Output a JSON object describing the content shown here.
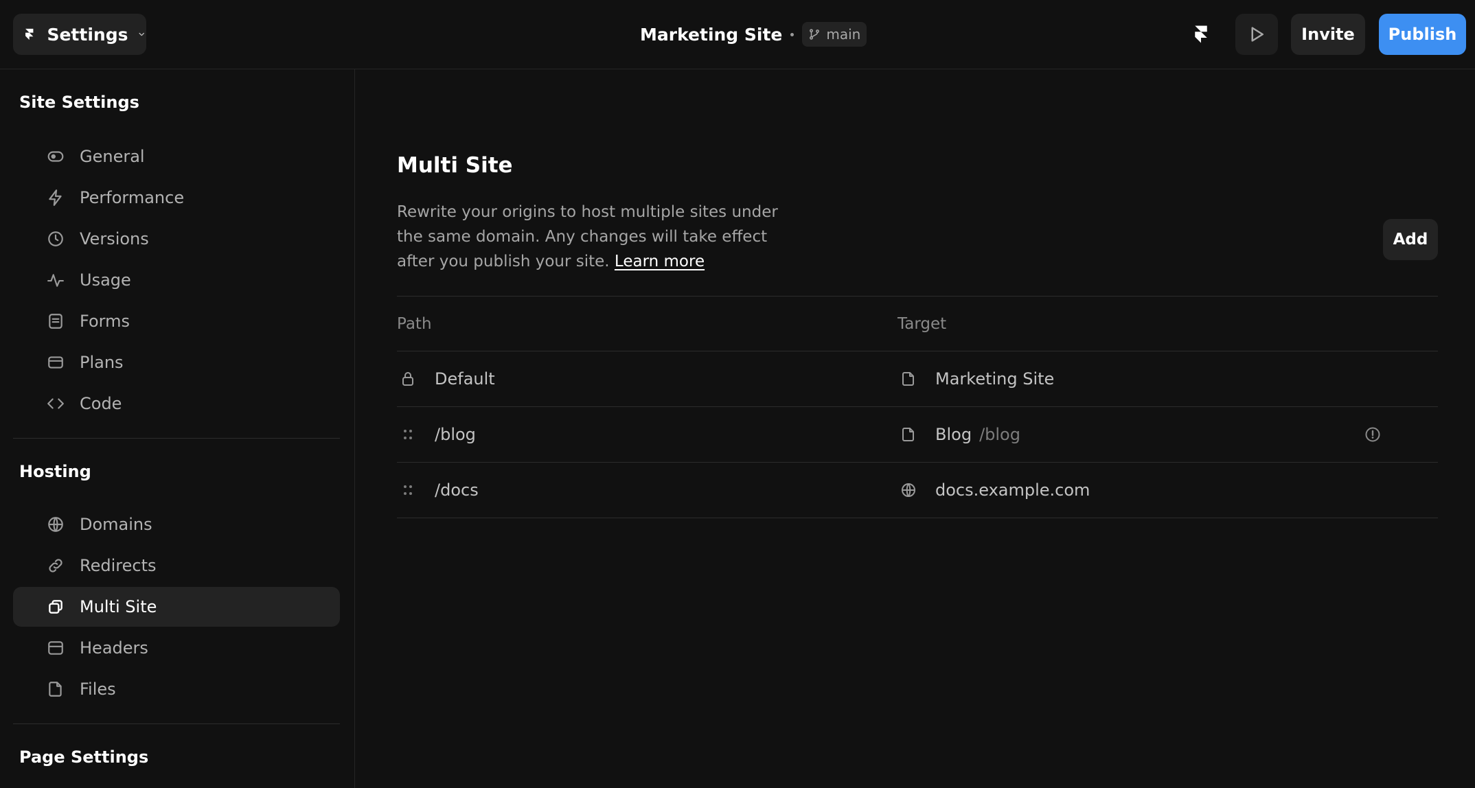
{
  "topbar": {
    "settings_label": "Settings",
    "project_name": "Marketing Site",
    "branch_name": "main",
    "invite_label": "Invite",
    "publish_label": "Publish",
    "accent_color": "#3d8ff2"
  },
  "sidebar": {
    "site_settings_title": "Site Settings",
    "site_items": [
      {
        "label": "General",
        "icon": "toggle-icon"
      },
      {
        "label": "Performance",
        "icon": "lightning-icon"
      },
      {
        "label": "Versions",
        "icon": "clock-icon"
      },
      {
        "label": "Usage",
        "icon": "activity-icon"
      },
      {
        "label": "Forms",
        "icon": "form-icon"
      },
      {
        "label": "Plans",
        "icon": "card-icon"
      },
      {
        "label": "Code",
        "icon": "code-icon"
      }
    ],
    "hosting_title": "Hosting",
    "hosting_items": [
      {
        "label": "Domains",
        "icon": "globe-icon"
      },
      {
        "label": "Redirects",
        "icon": "link-icon"
      },
      {
        "label": "Multi Site",
        "icon": "stack-icon",
        "active": true
      },
      {
        "label": "Headers",
        "icon": "header-icon"
      },
      {
        "label": "Files",
        "icon": "file-icon"
      }
    ],
    "page_settings_title": "Page Settings"
  },
  "main": {
    "title": "Multi Site",
    "description": "Rewrite your origins to host multiple sites under the same domain. Any changes will take effect after you publish your site.",
    "learn_more": "Learn more",
    "add_label": "Add",
    "table": {
      "headers": {
        "path": "Path",
        "target": "Target"
      },
      "rows": [
        {
          "path": "Default",
          "path_icon": "lock-icon",
          "target": "Marketing Site",
          "target_sub": "",
          "target_icon": "file-icon",
          "warning": false
        },
        {
          "path": "/blog",
          "path_icon": "drag-handle-icon",
          "target": "Blog",
          "target_sub": "/blog",
          "target_icon": "file-icon",
          "warning": true
        },
        {
          "path": "/docs",
          "path_icon": "drag-handle-icon",
          "target": "docs.example.com",
          "target_sub": "",
          "target_icon": "globe-icon",
          "warning": false
        }
      ]
    }
  }
}
